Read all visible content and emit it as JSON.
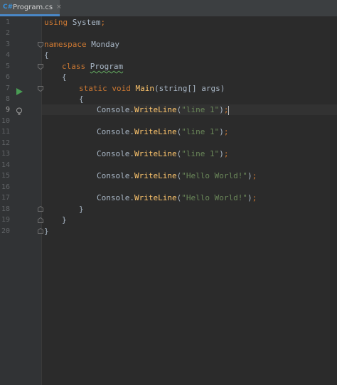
{
  "tab": {
    "icon_text": "C#",
    "label": "Program.cs",
    "close": "×"
  },
  "line_numbers": [
    "1",
    "2",
    "3",
    "4",
    "5",
    "6",
    "7",
    "8",
    "9",
    "10",
    "11",
    "12",
    "13",
    "14",
    "15",
    "16",
    "17",
    "18",
    "19",
    "20"
  ],
  "code": {
    "l1_kw": "using",
    "l1_ns": " System",
    "l1_semi": ";",
    "l3_kw": "namespace",
    "l3_ns": " Monday",
    "l4": "{",
    "l5_kw": "class",
    "l5_cls": "Program",
    "l6": "{",
    "l7_kw1": "static",
    "l7_kw2": "void",
    "l7_method": "Main",
    "l7_args": "(string[] args)",
    "l8": "{",
    "stmt_obj": "Console.",
    "stmt_method": "WriteLine",
    "l9_str": "\"line 1\"",
    "l11_str": "\"line 1\"",
    "l13_str": "\"line 1\"",
    "l15_str": "\"Hello World!\"",
    "l17_str": "\"Hello World!\"",
    "l18": "}",
    "l19": "}",
    "l20": "}"
  },
  "icons": {
    "run": "run-gutter-icon",
    "bulb": "quickfix-bulb-icon",
    "fold": "fold-marker-icon"
  },
  "colors": {
    "background": "#2b2b2b",
    "keyword": "#cc7832",
    "method": "#ffc66d",
    "string": "#6a8759",
    "text": "#a9b7c6",
    "line_number": "#606366",
    "run_green": "#499c54"
  }
}
